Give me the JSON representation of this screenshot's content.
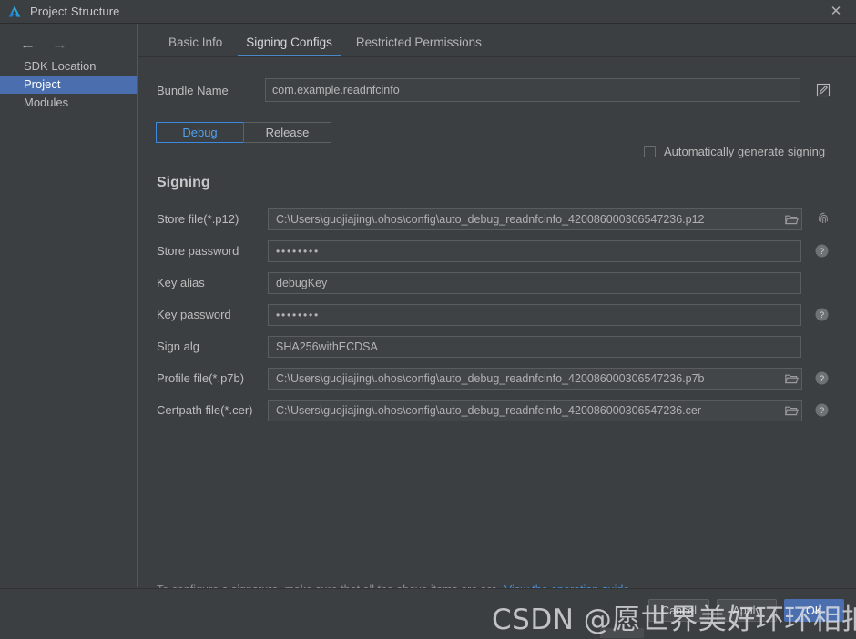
{
  "window": {
    "title": "Project Structure",
    "app_icon": "hdc-triangle-icon",
    "close_label": "✕"
  },
  "sidebar": {
    "back_arrow": "←",
    "forward_arrow": "→",
    "items": [
      {
        "label": "SDK Location",
        "selected": false
      },
      {
        "label": "Project",
        "selected": true
      },
      {
        "label": "Modules",
        "selected": false
      }
    ]
  },
  "tabs": [
    {
      "label": "Basic Info",
      "active": false
    },
    {
      "label": "Signing Configs",
      "active": true
    },
    {
      "label": "Restricted Permissions",
      "active": false
    }
  ],
  "bundle": {
    "label": "Bundle Name",
    "value": "com.example.readnfcinfo",
    "placeholder": "",
    "edit_icon": "pencil-edit-icon"
  },
  "build_variants": [
    {
      "label": "Debug",
      "active": true
    },
    {
      "label": "Release",
      "active": false
    }
  ],
  "auto_generate": {
    "label": "Automatically generate signing",
    "checked": false
  },
  "signing": {
    "section_title": "Signing",
    "fields": [
      {
        "label": "Store file(*.p12)",
        "value": "C:\\Users\\guojiajing\\.ohos\\config\\auto_debug_readnfcinfo_420086000306547236.p12",
        "type": "path",
        "has_folder": true,
        "trailing_icon": "fingerprint-icon",
        "disabled": true
      },
      {
        "label": "Store password",
        "value": "••••••••",
        "type": "password",
        "has_folder": false,
        "trailing_icon": "help-icon",
        "disabled": false
      },
      {
        "label": "Key alias",
        "value": "debugKey",
        "type": "text",
        "has_folder": false,
        "trailing_icon": "",
        "disabled": false
      },
      {
        "label": "Key password",
        "value": "••••••••",
        "type": "password",
        "has_folder": false,
        "trailing_icon": "help-icon",
        "disabled": false
      },
      {
        "label": "Sign alg",
        "value": "SHA256withECDSA",
        "type": "text",
        "has_folder": false,
        "trailing_icon": "",
        "disabled": false
      },
      {
        "label": "Profile file(*.p7b)",
        "value": "C:\\Users\\guojiajing\\.ohos\\config\\auto_debug_readnfcinfo_420086000306547236.p7b",
        "type": "path",
        "has_folder": true,
        "trailing_icon": "help-icon",
        "disabled": true
      },
      {
        "label": "Certpath file(*.cer)",
        "value": "C:\\Users\\guojiajing\\.ohos\\config\\auto_debug_readnfcinfo_420086000306547236.cer",
        "type": "path",
        "has_folder": true,
        "trailing_icon": "help-icon",
        "disabled": true
      }
    ]
  },
  "hint": {
    "text": "To configure a signature, make sure that all the above items are set.",
    "link": "View the operation guide"
  },
  "footer_buttons": [
    {
      "label": "Cancel",
      "primary": false
    },
    {
      "label": "Apply",
      "primary": false
    },
    {
      "label": "OK",
      "primary": true
    }
  ],
  "watermark": {
    "text": "CSDN @愿世界美好环环相扣"
  },
  "colors": {
    "window_bg": "#3c3f41",
    "accent_blue": "#4b6eaf",
    "tab_underline": "#4a88c7",
    "active_segment": "#3d8ae2",
    "link": "#4c8fd6",
    "text": "#bbbbbb",
    "field_bg": "#3f4244",
    "field_border": "#5a5d5f"
  }
}
